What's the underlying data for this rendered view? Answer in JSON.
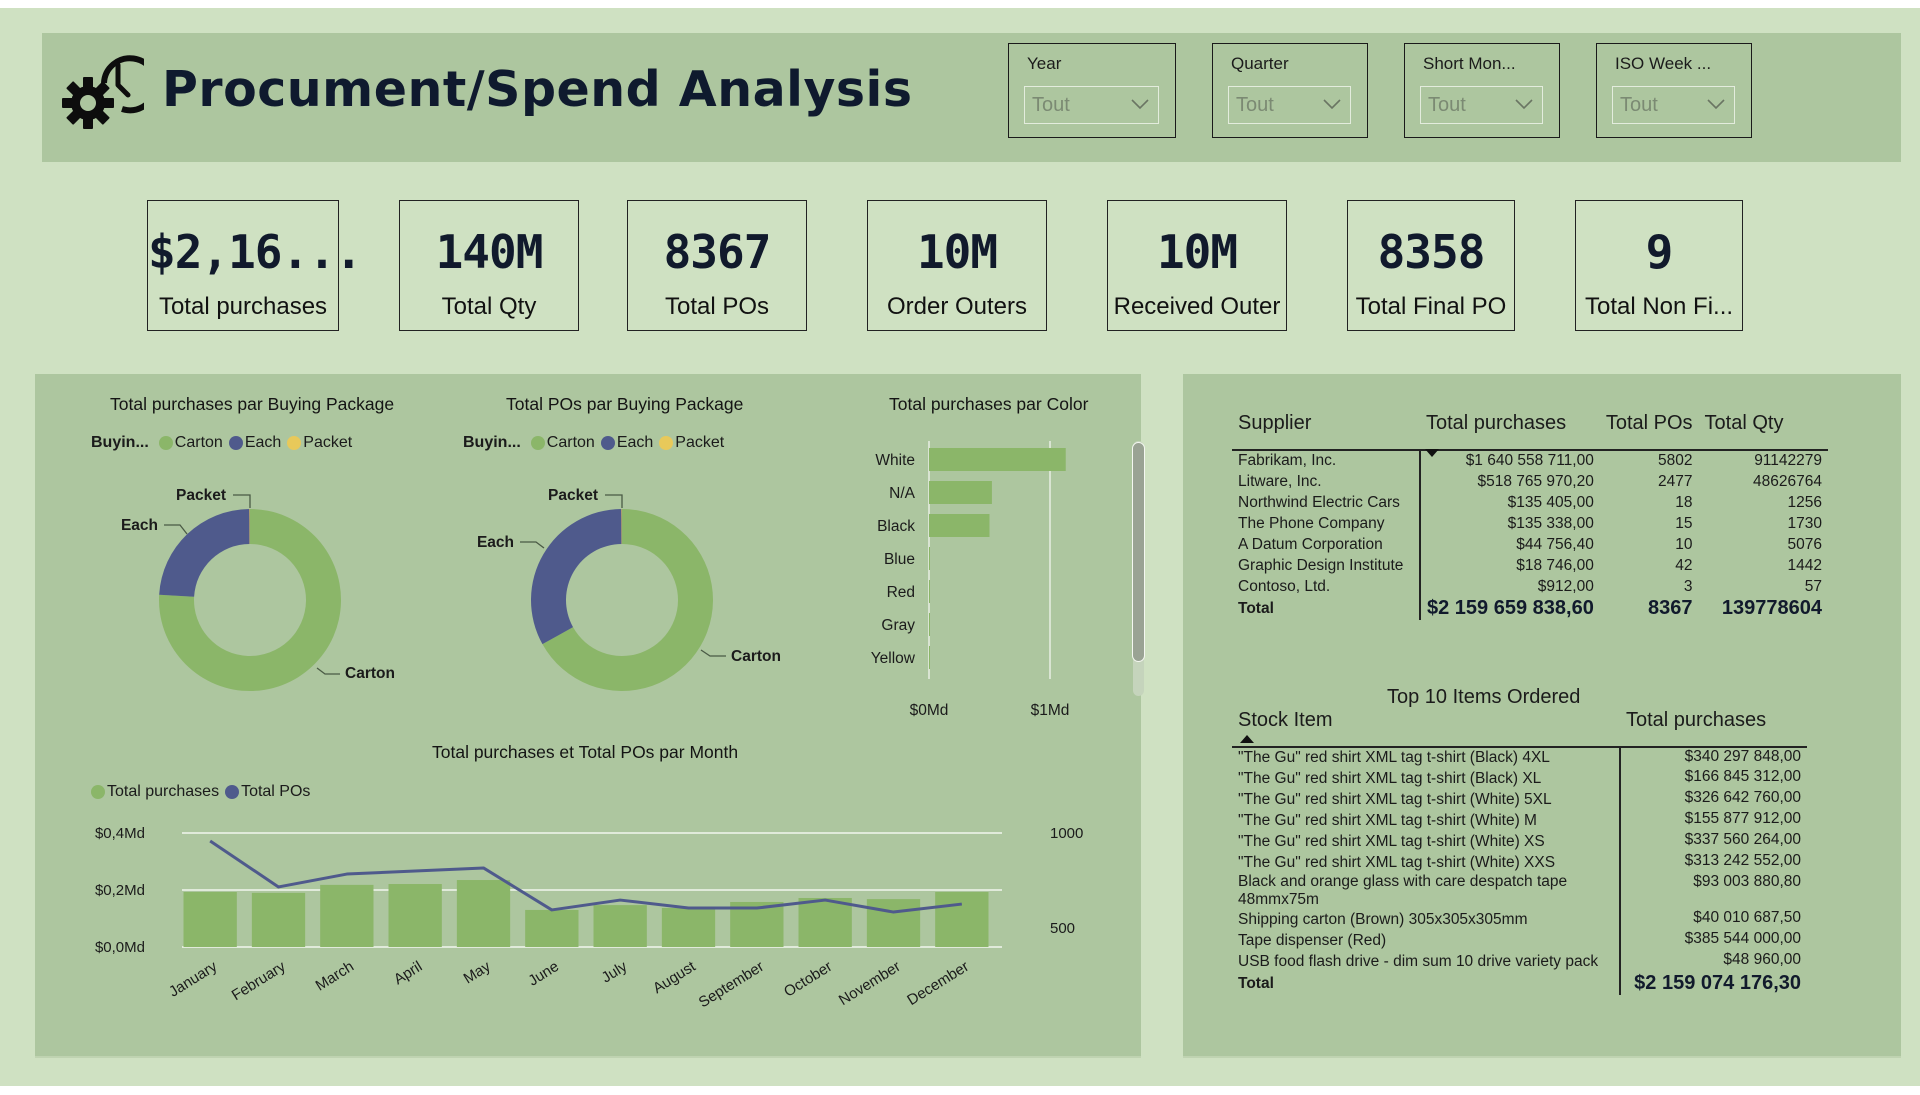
{
  "header": {
    "title": "Procument/Spend Analysis",
    "logo_icon": "gear-clock-icon"
  },
  "slicers": [
    {
      "label": "Year",
      "value": "Tout"
    },
    {
      "label": "Quarter",
      "value": "Tout"
    },
    {
      "label": "Short Mon...",
      "value": "Tout"
    },
    {
      "label": "ISO Week ...",
      "value": "Tout"
    }
  ],
  "kpis": [
    {
      "value": "$2,16...",
      "label": "Total purchases"
    },
    {
      "value": "140M",
      "label": "Total Qty"
    },
    {
      "value": "8367",
      "label": "Total POs"
    },
    {
      "value": "10M",
      "label": "Order Outers"
    },
    {
      "value": "10M",
      "label": "Received Outer"
    },
    {
      "value": "8358",
      "label": "Total Final PO"
    },
    {
      "value": "9",
      "label": "Total Non Fi..."
    }
  ],
  "colors": {
    "carton": "#8bb669",
    "each": "#4f5a8c",
    "packet": "#e8c95a",
    "panel": "#adc69f",
    "background": "#cfe1c2"
  },
  "chart_data": [
    {
      "type": "pie",
      "variant": "donut",
      "title": "Total purchases par Buying Package",
      "legend_title": "Buyin...",
      "legend_position": "top-left",
      "categories": [
        "Carton",
        "Each",
        "Packet"
      ],
      "values": [
        0.76,
        0.24,
        0.001
      ],
      "value_units": "share of total (estimated)"
    },
    {
      "type": "pie",
      "variant": "donut",
      "title": "Total POs par Buying Package",
      "legend_title": "Buyin...",
      "legend_position": "top-left",
      "categories": [
        "Carton",
        "Each",
        "Packet"
      ],
      "values": [
        0.67,
        0.33,
        0.001
      ],
      "value_units": "share of total (estimated)"
    },
    {
      "type": "bar",
      "orientation": "horizontal",
      "title": "Total purchases par Color",
      "categories": [
        "White",
        "N/A",
        "Black",
        "Blue",
        "Red",
        "Gray",
        "Yellow"
      ],
      "values": [
        1.13,
        0.52,
        0.5,
        0.003,
        0.002,
        0.001,
        0.001
      ],
      "xlabel": "",
      "ylabel": "",
      "xlim": [
        0,
        1.3
      ],
      "xticks": [
        {
          "v": 0,
          "label": "$0Md"
        },
        {
          "v": 1,
          "label": "$1Md"
        }
      ],
      "grid": true
    },
    {
      "type": "bar",
      "combo": "bar+line",
      "title": "Total purchases et Total POs par Month",
      "legend_position": "top-left",
      "categories": [
        "January",
        "February",
        "March",
        "April",
        "May",
        "June",
        "July",
        "August",
        "September",
        "October",
        "November",
        "December"
      ],
      "series": [
        {
          "name": "Total purchases",
          "type": "bar",
          "axis": "left",
          "values": [
            0.193,
            0.19,
            0.218,
            0.221,
            0.235,
            0.13,
            0.147,
            0.137,
            0.158,
            0.172,
            0.168,
            0.193
          ]
        },
        {
          "name": "Total POs",
          "type": "line",
          "axis": "right",
          "values": [
            958,
            716,
            784,
            800,
            816,
            595,
            647,
            605,
            605,
            647,
            584,
            626
          ]
        }
      ],
      "ylim": [
        0,
        0.4
      ],
      "yticks": [
        {
          "v": 0,
          "label": "$0,0Md"
        },
        {
          "v": 0.2,
          "label": "$0,2Md"
        },
        {
          "v": 0.4,
          "label": "$0,4Md"
        }
      ],
      "y2lim": [
        400,
        1000
      ],
      "y2ticks": [
        {
          "v": 500,
          "label": "500"
        },
        {
          "v": 1000,
          "label": "1000"
        }
      ],
      "grid": true
    }
  ],
  "supplier_table": {
    "columns": [
      "Supplier",
      "Total purchases",
      "Total POs",
      "Total Qty"
    ],
    "sorted_column": "Total purchases",
    "sort_direction": "descending",
    "rows": [
      [
        "Fabrikam, Inc.",
        "$1 640 558 711,00",
        "5802",
        "91142279"
      ],
      [
        "Litware, Inc.",
        "$518 765 970,20",
        "2477",
        "48626764"
      ],
      [
        "Northwind Electric Cars",
        "$135 405,00",
        "18",
        "1256"
      ],
      [
        "The Phone Company",
        "$135 338,00",
        "15",
        "1730"
      ],
      [
        "A Datum Corporation",
        "$44 756,40",
        "10",
        "5076"
      ],
      [
        "Graphic Design Institute",
        "$18 746,00",
        "42",
        "1442"
      ],
      [
        "Contoso, Ltd.",
        "$912,00",
        "3",
        "57"
      ]
    ],
    "total": [
      "Total",
      "$2 159 659 838,60",
      "8367",
      "139778604"
    ]
  },
  "items_table": {
    "title": "Top 10 Items Ordered",
    "columns": [
      "Stock Item",
      "Total purchases"
    ],
    "sorted_column": "Stock Item",
    "sort_direction": "ascending",
    "rows": [
      [
        "\"The Gu\" red shirt XML tag t-shirt (Black) 4XL",
        "$340 297 848,00"
      ],
      [
        "\"The Gu\" red shirt XML tag t-shirt (Black) XL",
        "$166 845 312,00"
      ],
      [
        "\"The Gu\" red shirt XML tag t-shirt (White) 5XL",
        "$326 642 760,00"
      ],
      [
        "\"The Gu\" red shirt XML tag t-shirt (White) M",
        "$155 877 912,00"
      ],
      [
        "\"The Gu\" red shirt XML tag t-shirt (White) XS",
        "$337 560 264,00"
      ],
      [
        "\"The Gu\" red shirt XML tag t-shirt (White) XXS",
        "$313 242 552,00"
      ],
      [
        "Black and orange glass with care despatch tape 48mmx75m",
        "$93 003 880,80"
      ],
      [
        "Shipping carton (Brown) 305x305x305mm",
        "$40 010 687,50"
      ],
      [
        "Tape dispenser (Red)",
        "$385 544 000,00"
      ],
      [
        "USB food flash drive - dim sum 10 drive variety pack",
        "$48 960,00"
      ]
    ],
    "total": [
      "Total",
      "$2 159 074 176,30"
    ]
  }
}
